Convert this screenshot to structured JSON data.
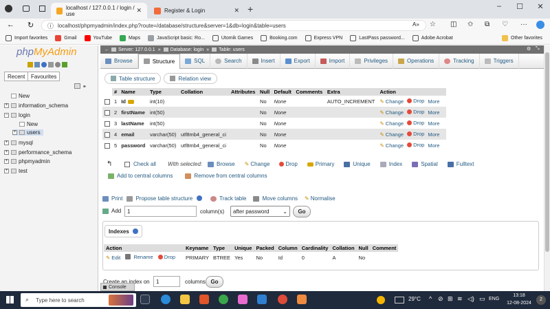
{
  "browser": {
    "tabs": [
      {
        "label": "localhost / 127.0.0.1 / login / use",
        "active": true,
        "color": "#f5a623"
      },
      {
        "label": "Register & Login",
        "active": false,
        "color": "#f26b3a"
      }
    ],
    "url": "localhost/phpmyadmin/index.php?route=/database/structure&server=1&db=login&table=users",
    "bookmarks": [
      "Import favorites",
      "Gmail",
      "YouTube",
      "Maps",
      "JavaScript basic: Ro...",
      "Utomik Games",
      "Booking.com",
      "Express VPN",
      "LastPass password...",
      "Adobe Acrobat"
    ],
    "other_favorites": "Other favorites"
  },
  "sidebar": {
    "logo_php": "php",
    "logo_myadmin": "MyAdmin",
    "tab_recent": "Recent",
    "tab_favourites": "Favourites",
    "tree": [
      {
        "label": "New",
        "level": 0
      },
      {
        "label": "information_schema",
        "level": 0
      },
      {
        "label": "login",
        "level": 0
      },
      {
        "label": "New",
        "level": 1
      },
      {
        "label": "users",
        "level": 1
      },
      {
        "label": "mysql",
        "level": 0
      },
      {
        "label": "performance_schema",
        "level": 0
      },
      {
        "label": "phpmyadmin",
        "level": 0
      },
      {
        "label": "test",
        "level": 0
      }
    ]
  },
  "breadcrumb": {
    "server": "Server: 127.0.0.1",
    "database": "Database: login",
    "table": "Table: users"
  },
  "menu": [
    "Browse",
    "Structure",
    "SQL",
    "Search",
    "Insert",
    "Export",
    "Import",
    "Privileges",
    "Operations",
    "Tracking",
    "Triggers"
  ],
  "subtabs": [
    "Table structure",
    "Relation view"
  ],
  "structure": {
    "headers": [
      "#",
      "Name",
      "Type",
      "Collation",
      "Attributes",
      "Null",
      "Default",
      "Comments",
      "Extra",
      "Action"
    ],
    "rows": [
      {
        "num": "1",
        "name": "Id",
        "type": "int(10)",
        "collation": "",
        "attributes": "",
        "null": "No",
        "default": "None",
        "comments": "",
        "extra": "AUTO_INCREMENT"
      },
      {
        "num": "2",
        "name": "firstName",
        "type": "int(50)",
        "collation": "",
        "attributes": "",
        "null": "No",
        "default": "None",
        "comments": "",
        "extra": ""
      },
      {
        "num": "3",
        "name": "lastName",
        "type": "int(50)",
        "collation": "",
        "attributes": "",
        "null": "No",
        "default": "None",
        "comments": "",
        "extra": ""
      },
      {
        "num": "4",
        "name": "email",
        "type": "varchar(50)",
        "collation": "utf8mb4_general_ci",
        "attributes": "",
        "null": "No",
        "default": "None",
        "comments": "",
        "extra": ""
      },
      {
        "num": "5",
        "name": "password",
        "type": "varchar(50)",
        "collation": "utf8mb4_general_ci",
        "attributes": "",
        "null": "No",
        "default": "None",
        "comments": "",
        "extra": ""
      }
    ],
    "action_change": "Change",
    "action_drop": "Drop",
    "action_more": "More"
  },
  "bulk": {
    "check_all": "Check all",
    "with_selected": "With selected:",
    "actions": [
      "Browse",
      "Change",
      "Drop",
      "Primary",
      "Unique",
      "Index",
      "Spatial",
      "Fulltext"
    ],
    "add_central": "Add to central columns",
    "remove_central": "Remove from central columns"
  },
  "tools": {
    "print": "Print",
    "propose": "Propose table structure",
    "track": "Track table",
    "move": "Move columns",
    "normalise": "Normalise",
    "add_label": "Add",
    "add_value": "1",
    "columns_label": "column(s)",
    "position_select": "after password",
    "go": "Go"
  },
  "indexes": {
    "title": "Indexes",
    "headers": [
      "Action",
      "Keyname",
      "Type",
      "Unique",
      "Packed",
      "Column",
      "Cardinality",
      "Collation",
      "Null",
      "Comment"
    ],
    "row": {
      "edit": "Edit",
      "rename": "Rename",
      "drop": "Drop",
      "keyname": "PRIMARY",
      "type": "BTREE",
      "unique": "Yes",
      "packed": "No",
      "column": "Id",
      "cardinality": "0",
      "collation": "A",
      "null": "No",
      "comment": ""
    },
    "create_label": "Create an index on",
    "create_value": "1",
    "columns_label": "columns",
    "go": "Go"
  },
  "console": "Console",
  "taskbar": {
    "search_placeholder": "Type here to search",
    "temperature": "29°C",
    "lang": "ENG",
    "time": "13:18",
    "date": "12-08-2024",
    "notifications": "2"
  }
}
